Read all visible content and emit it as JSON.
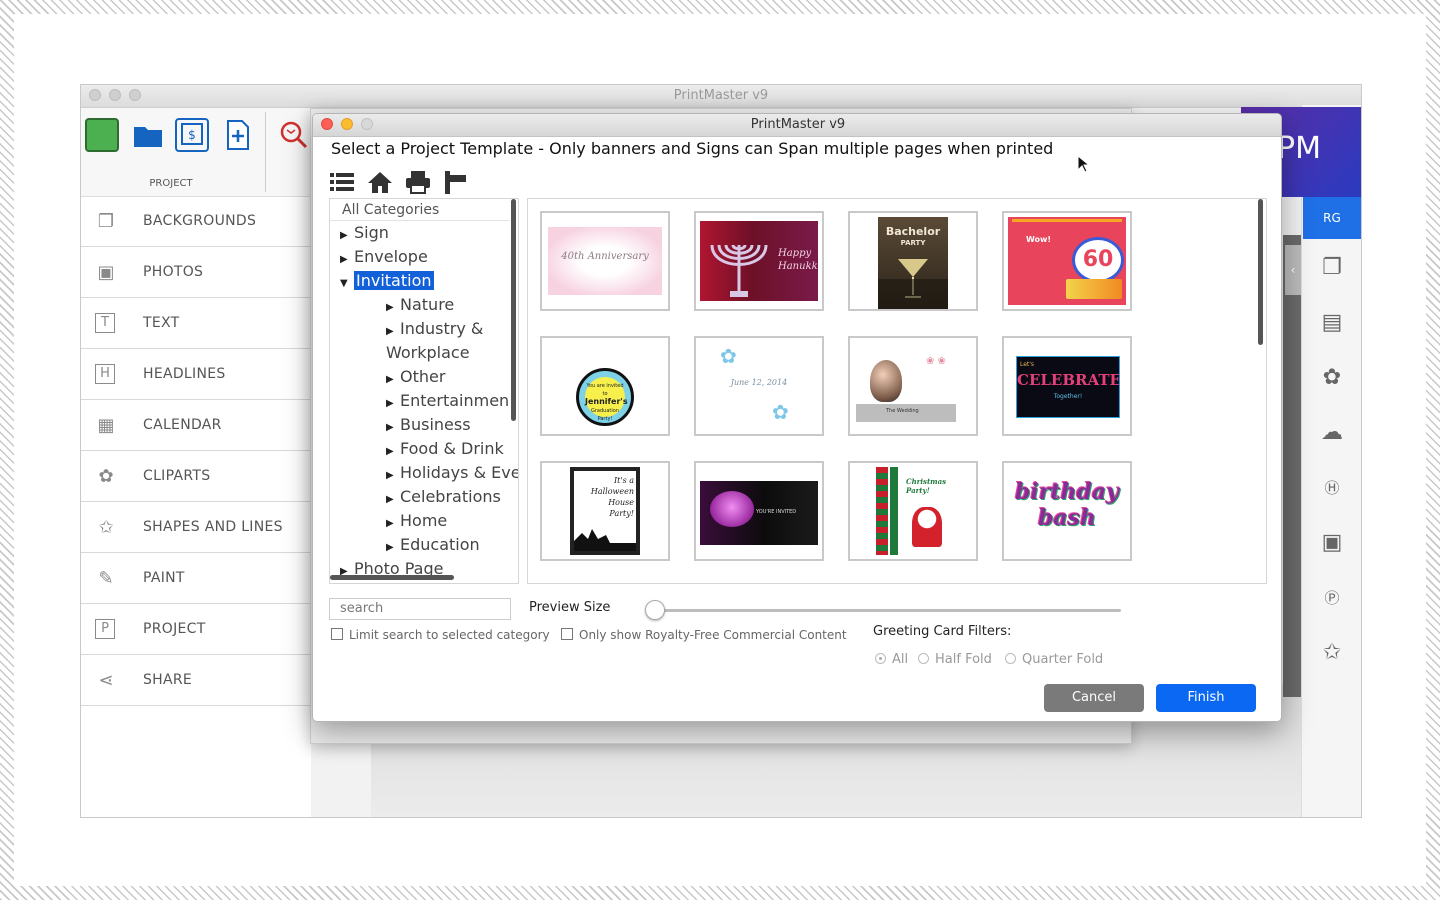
{
  "app": {
    "title": "PrintMaster v9",
    "toolbar_section_label": "PROJECT",
    "sidebar": [
      {
        "label": "BACKGROUNDS",
        "icon": "backgrounds-icon"
      },
      {
        "label": "PHOTOS",
        "icon": "photos-icon"
      },
      {
        "label": "TEXT",
        "icon": "text-icon"
      },
      {
        "label": "HEADLINES",
        "icon": "headlines-icon"
      },
      {
        "label": "CALENDAR",
        "icon": "calendar-icon"
      },
      {
        "label": "CLIPARTS",
        "icon": "cliparts-icon"
      },
      {
        "label": "SHAPES AND LINES",
        "icon": "shapes-icon"
      },
      {
        "label": "PAINT",
        "icon": "paint-icon"
      },
      {
        "label": "PROJECT",
        "icon": "project-icon"
      },
      {
        "label": "SHARE",
        "icon": "share-icon"
      }
    ],
    "brand_text": "PM",
    "user_initials": "RG",
    "accent_color": "#1f6fe6"
  },
  "dialog": {
    "title": "PrintMaster v9",
    "heading": "Select a Project Template - Only banners and Signs can Span multiple pages when printed",
    "categories_header": "All Categories",
    "categories": {
      "sign": "Sign",
      "envelope": "Envelope",
      "invitation": "Invitation",
      "nature": "Nature",
      "industry_1": "Industry &",
      "industry_2": "Workplace",
      "other": "Other",
      "entertainment": "Entertainmen",
      "business": "Business",
      "food": "Food & Drink",
      "holidays": "Holidays & Eve",
      "celebrations": "Celebrations",
      "home": "Home",
      "education": "Education",
      "photo_page": "Photo Page"
    },
    "thumbnails": {
      "anniversary": "40th Anniversary",
      "hanukkah_1": "Happy",
      "hanukkah_2": "Hanukkah",
      "bachelor_1": "Bachelor",
      "bachelor_2": "PARTY",
      "sixty_1": "Wow!",
      "sixty_2": "60",
      "grad_1": "You are invited to",
      "grad_2": "Jennifer's",
      "grad_3": "Graduation Party!",
      "save_date": "June 12, 2014",
      "wedding": "The Wedding",
      "celebrate_1": "Let's",
      "celebrate_2": "CELEBRATE",
      "celebrate_3": "Together!",
      "halloween_1": "It's a",
      "halloween_2": "Halloween",
      "halloween_3": "House",
      "halloween_4": "Party!",
      "invited": "YOU'RE INVITED",
      "christmas_1": "Christmas",
      "christmas_2": "Party!",
      "birthday_1": "birthday",
      "birthday_2": "bash"
    },
    "search_placeholder": "search",
    "limit_search_label": "Limit search to selected category",
    "royalty_free_label": "Only show Royalty-Free Commercial Content",
    "preview_size_label": "Preview Size",
    "preview_size_value": 0,
    "greeting_filters_label": "Greeting Card Filters:",
    "filter_all": "All",
    "filter_half": "Half Fold",
    "filter_quarter": "Quarter Fold",
    "cancel_label": "Cancel",
    "finish_label": "Finish"
  }
}
